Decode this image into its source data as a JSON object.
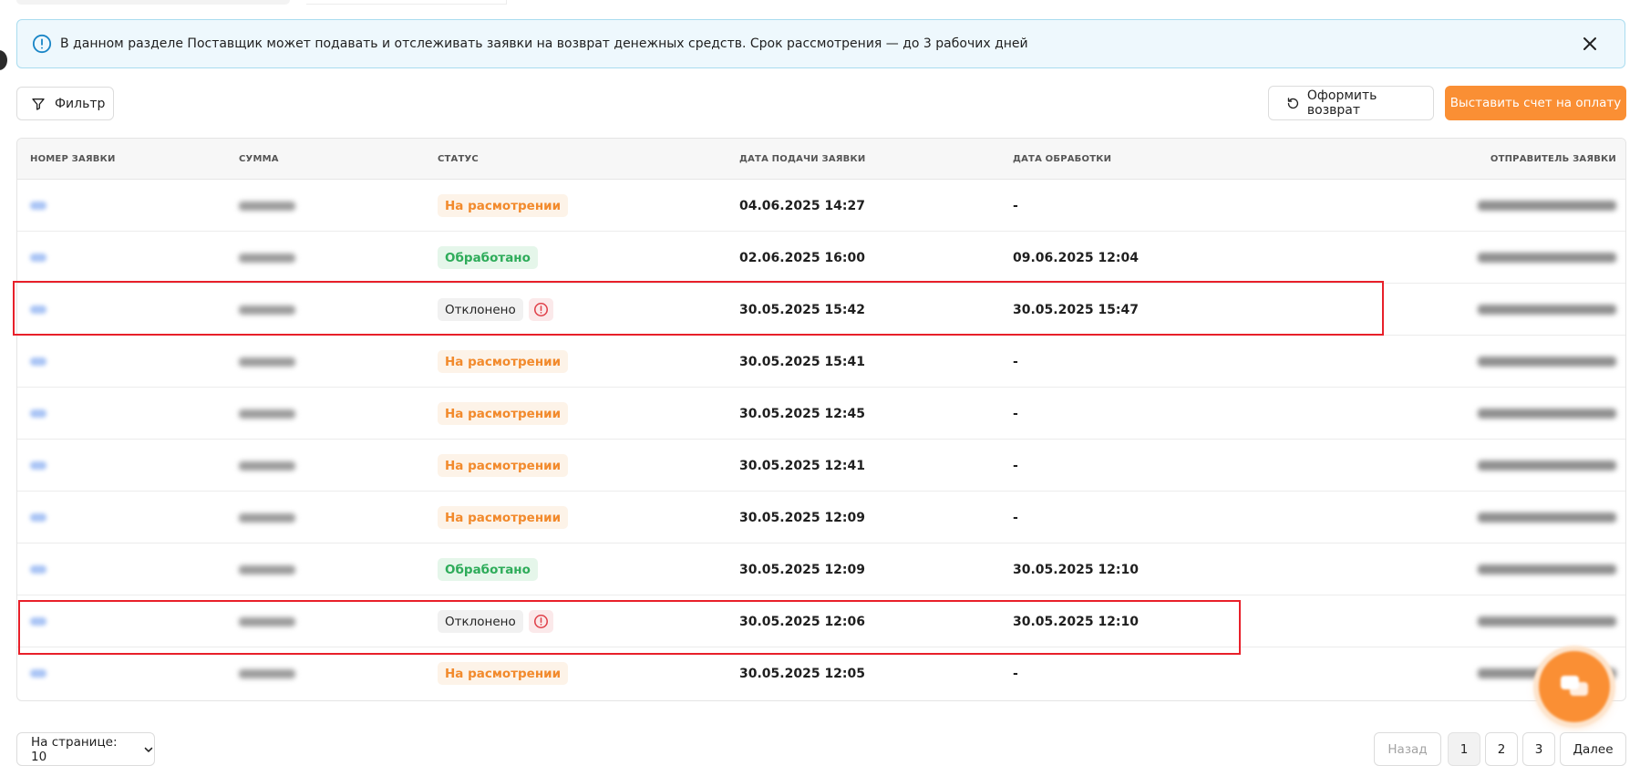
{
  "banner": {
    "text": "В данном разделе Поставщик может подавать и отслеживать заявки на возврат денежных средств. Срок рассмотрения — до 3 рабочих дней",
    "info_icon": "info-circle-icon",
    "close_icon": "close-icon",
    "accent_color": "#1a86c7"
  },
  "toolbar": {
    "filter_label": "Фильтр",
    "return_label": "Оформить возврат",
    "invoice_label": "Выставить счет на оплату",
    "invoice_color": "#fa8f34"
  },
  "table": {
    "headers": {
      "id": "НОМЕР ЗАЯВКИ",
      "sum": "СУММА",
      "status": "СТАТУС",
      "submitted": "ДАТА ПОДАЧИ ЗАЯВКИ",
      "processed": "ДАТА ОБРАБОТКИ",
      "sender": "ОТПРАВИТЕЛЬ ЗАЯВКИ"
    },
    "rows": [
      {
        "status": "На расмотрении",
        "status_type": "review",
        "submitted": "04.06.2025 14:27",
        "processed": "-"
      },
      {
        "status": "Обработано",
        "status_type": "done",
        "submitted": "02.06.2025 16:00",
        "processed": "09.06.2025 12:04"
      },
      {
        "status": "Отклонено",
        "status_type": "rejected",
        "submitted": "30.05.2025 15:42",
        "processed": "30.05.2025 15:47"
      },
      {
        "status": "На расмотрении",
        "status_type": "review",
        "submitted": "30.05.2025 15:41",
        "processed": "-"
      },
      {
        "status": "На расмотрении",
        "status_type": "review",
        "submitted": "30.05.2025 12:45",
        "processed": "-"
      },
      {
        "status": "На расмотрении",
        "status_type": "review",
        "submitted": "30.05.2025 12:41",
        "processed": "-"
      },
      {
        "status": "На расмотрении",
        "status_type": "review",
        "submitted": "30.05.2025 12:09",
        "processed": "-"
      },
      {
        "status": "Обработано",
        "status_type": "done",
        "submitted": "30.05.2025 12:09",
        "processed": "30.05.2025 12:10"
      },
      {
        "status": "Отклонено",
        "status_type": "rejected",
        "submitted": "30.05.2025 12:06",
        "processed": "30.05.2025 12:10"
      },
      {
        "status": "На расмотрении",
        "status_type": "review",
        "submitted": "30.05.2025 12:05",
        "processed": "-"
      }
    ]
  },
  "colors": {
    "review": "#f28a2c",
    "done": "#2eac5a",
    "rejected_warning": "#e0424b",
    "highlight": "#e8202a"
  },
  "pagination": {
    "per_page_label": "На странице: 10",
    "back_label": "Назад",
    "pages": [
      "1",
      "2",
      "3"
    ],
    "current_page": "1",
    "next_label": "Далее"
  },
  "chat_fab_icon": "chat-bubbles-icon"
}
